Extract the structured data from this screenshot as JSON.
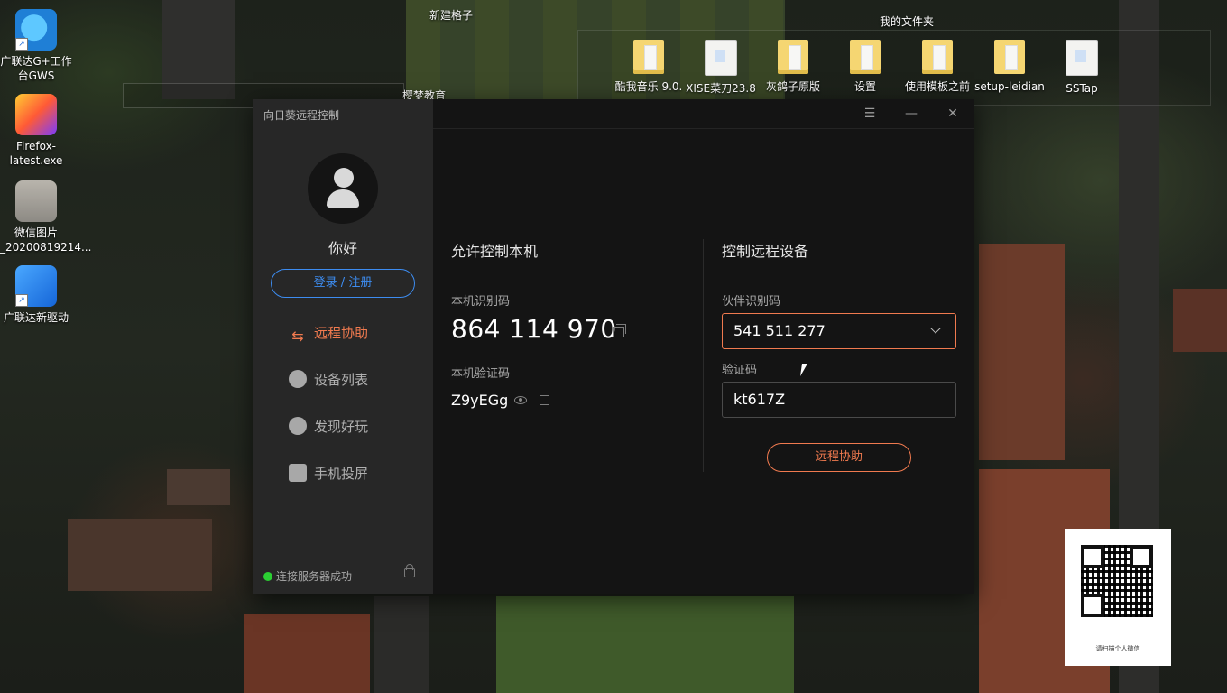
{
  "desktop": {
    "icons": [
      {
        "label": "广联达G+工作台GWS",
        "icon": "gws-icon"
      },
      {
        "label": "Firefox-latest.exe",
        "icon": "firefox-icon"
      },
      {
        "label": "微信图片_20200819214...",
        "icon": "image-file-icon"
      },
      {
        "label": "广联达新驱动",
        "icon": "driver-icon"
      }
    ],
    "fence_left_title": "新建格子",
    "fence_left_item": "樱梦教育",
    "fence_right_title": "我的文件夹",
    "folders": [
      {
        "label": "酷我音乐 9.0."
      },
      {
        "label": "XISE菜刀23.8"
      },
      {
        "label": "灰鸽子原版"
      },
      {
        "label": "设置"
      },
      {
        "label": "使用模板之前"
      },
      {
        "label": "setup-leidian"
      },
      {
        "label": "SSTap"
      }
    ],
    "qr_caption": "请扫描个人微信"
  },
  "app": {
    "title": "向日葵远程控制",
    "window_controls": {
      "menu": "☰",
      "minimize": "—",
      "close": "✕"
    },
    "sidebar": {
      "greeting": "你好",
      "login_label": "登录 / 注册",
      "nav": [
        {
          "label": "远程协助",
          "active": true,
          "icon": "remote-assist-icon"
        },
        {
          "label": "设备列表",
          "active": false,
          "icon": "device-list-icon"
        },
        {
          "label": "发现好玩",
          "active": false,
          "icon": "discover-icon"
        },
        {
          "label": "手机投屏",
          "active": false,
          "icon": "screen-cast-icon"
        }
      ],
      "status": "连接服务器成功",
      "status_color": "#2bcf33"
    },
    "allow": {
      "title": "允许控制本机",
      "id_label": "本机识别码",
      "id_value": "864 114 970",
      "code_label": "本机验证码",
      "code_value": "Z9yEGg"
    },
    "control": {
      "title": "控制远程设备",
      "partner_label": "伙伴识别码",
      "partner_value": "541 511 277",
      "verify_label": "验证码",
      "verify_value": "kt617Z",
      "button_label": "远程协助"
    },
    "accent_color": "#f07a4f",
    "link_color": "#3d8cf0"
  }
}
